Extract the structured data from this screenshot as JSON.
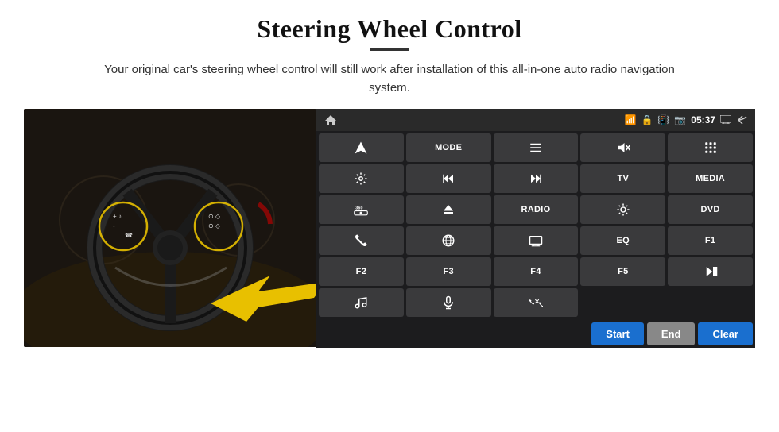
{
  "header": {
    "title": "Steering Wheel Control",
    "subtitle": "Your original car's steering wheel control will still work after installation of this all-in-one auto radio navigation system."
  },
  "status_bar": {
    "time": "05:37",
    "icons": [
      "wifi",
      "lock",
      "sim",
      "bluetooth",
      "display",
      "back"
    ]
  },
  "grid_buttons": [
    {
      "id": "row1",
      "buttons": [
        {
          "label": "navigate",
          "type": "icon",
          "icon": "navigate"
        },
        {
          "label": "MODE",
          "type": "text"
        },
        {
          "label": "list",
          "type": "icon",
          "icon": "list"
        },
        {
          "label": "mute",
          "type": "icon",
          "icon": "mute"
        },
        {
          "label": "apps",
          "type": "icon",
          "icon": "apps"
        }
      ]
    },
    {
      "id": "row2",
      "buttons": [
        {
          "label": "settings",
          "type": "icon",
          "icon": "settings"
        },
        {
          "label": "prev",
          "type": "icon",
          "icon": "prev"
        },
        {
          "label": "next",
          "type": "icon",
          "icon": "next"
        },
        {
          "label": "TV",
          "type": "text"
        },
        {
          "label": "MEDIA",
          "type": "text"
        }
      ]
    },
    {
      "id": "row3",
      "buttons": [
        {
          "label": "360cam",
          "type": "icon",
          "icon": "360cam"
        },
        {
          "label": "eject",
          "type": "icon",
          "icon": "eject"
        },
        {
          "label": "RADIO",
          "type": "text"
        },
        {
          "label": "brightness",
          "type": "icon",
          "icon": "brightness"
        },
        {
          "label": "DVD",
          "type": "text"
        }
      ]
    },
    {
      "id": "row4",
      "buttons": [
        {
          "label": "phone",
          "type": "icon",
          "icon": "phone"
        },
        {
          "label": "browser",
          "type": "icon",
          "icon": "browser"
        },
        {
          "label": "screen",
          "type": "icon",
          "icon": "screen"
        },
        {
          "label": "EQ",
          "type": "text"
        },
        {
          "label": "F1",
          "type": "text"
        }
      ]
    },
    {
      "id": "row5",
      "buttons": [
        {
          "label": "F2",
          "type": "text"
        },
        {
          "label": "F3",
          "type": "text"
        },
        {
          "label": "F4",
          "type": "text"
        },
        {
          "label": "F5",
          "type": "text"
        },
        {
          "label": "playpause",
          "type": "icon",
          "icon": "playpause"
        }
      ]
    },
    {
      "id": "row6",
      "buttons": [
        {
          "label": "music",
          "type": "icon",
          "icon": "music"
        },
        {
          "label": "mic",
          "type": "icon",
          "icon": "mic"
        },
        {
          "label": "phonecall",
          "type": "icon",
          "icon": "phonecall"
        },
        {
          "label": "",
          "type": "empty"
        },
        {
          "label": "",
          "type": "empty"
        }
      ]
    }
  ],
  "bottom_buttons": {
    "start": "Start",
    "end": "End",
    "clear": "Clear"
  }
}
